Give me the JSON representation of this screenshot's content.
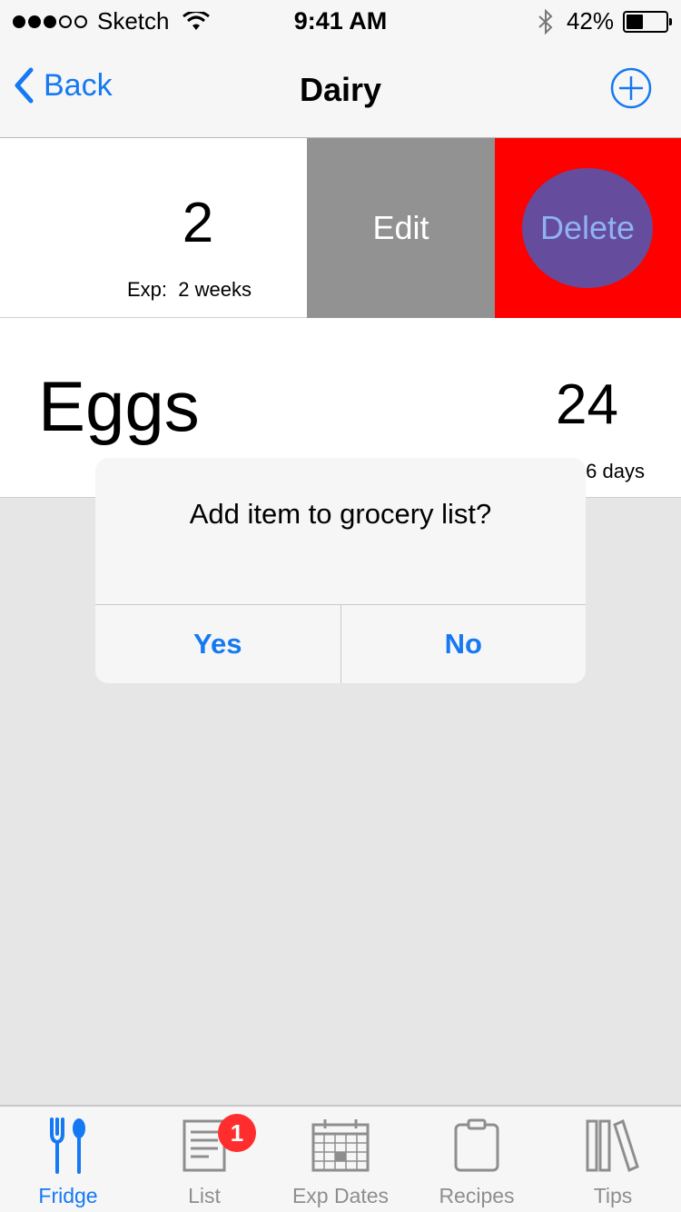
{
  "status_bar": {
    "carrier": "Sketch",
    "time": "9:41 AM",
    "battery": "42%",
    "battery_level": 0.42
  },
  "nav": {
    "back_label": "Back",
    "title": "Dairy"
  },
  "swiped_row": {
    "quantity": "2",
    "exp_label": "Exp:  2 weeks",
    "edit_label": "Edit",
    "delete_label": "Delete"
  },
  "eggs_row": {
    "name": "Eggs",
    "quantity": "24",
    "exp_visible": "6 days"
  },
  "alert": {
    "message": "Add item to grocery list?",
    "yes_label": "Yes",
    "no_label": "No"
  },
  "tabs": [
    {
      "label": "Fridge",
      "icon": "fork-spoon-icon",
      "active": true
    },
    {
      "label": "List",
      "icon": "list-icon",
      "badge": "1"
    },
    {
      "label": "Exp Dates",
      "icon": "calendar-icon"
    },
    {
      "label": "Recipes",
      "icon": "clipboard-icon"
    },
    {
      "label": "Tips",
      "icon": "books-icon"
    }
  ],
  "colors": {
    "accent": "#1479f2",
    "delete": "#fe0000",
    "edit": "#929292",
    "badge": "#ff2d2d"
  }
}
